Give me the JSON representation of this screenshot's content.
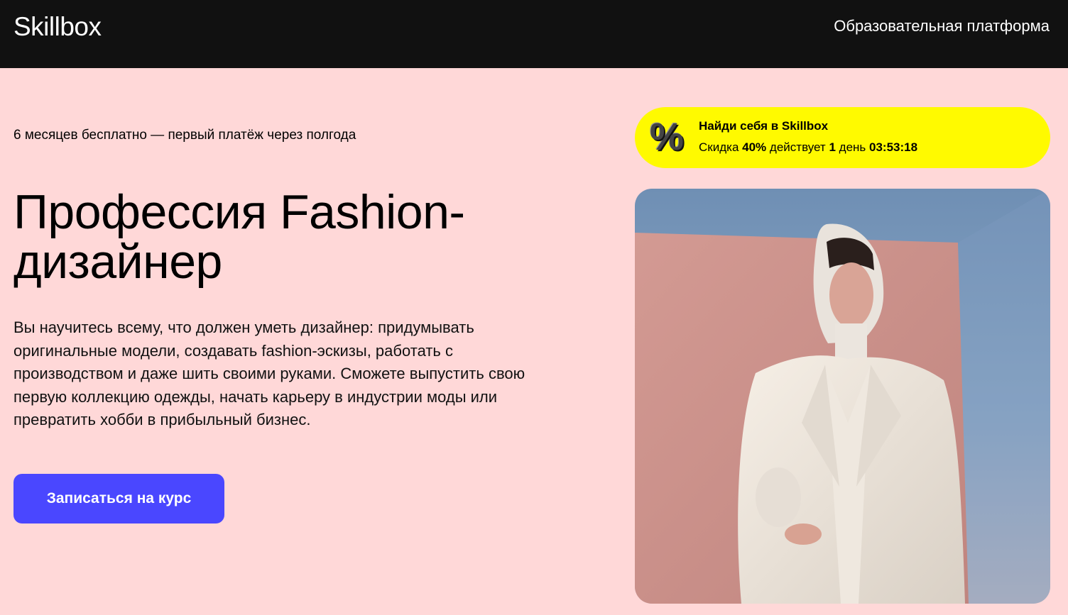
{
  "header": {
    "logo": "Skillbox",
    "platform_link": "Образовательная платформа"
  },
  "hero": {
    "promo_line": "6 месяцев бесплатно — первый платёж через полгода",
    "title": "Профессия Fashion-дизайнер",
    "description": "Вы научитесь всему, что должен уметь дизайнер: придумывать оригинальные модели, создавать fashion-эскизы, работать с производством и даже шить своими руками. Сможете выпустить свою первую коллекцию одежды, начать карьеру в индустрии моды или превратить хобби в прибыльный бизнес.",
    "cta_label": "Записаться на курс"
  },
  "discount": {
    "icon": "percent-icon",
    "icon_glyph": "%",
    "title": "Найди себя в Skillbox",
    "prefix": "Скидка",
    "percent": "40%",
    "middle": "действует",
    "days": "1",
    "days_label": "день",
    "timer": "03:53:18"
  },
  "colors": {
    "page_background": "#ffd8d8",
    "header_background": "#111111",
    "cta_background": "#4a47ff",
    "discount_background": "#fffa00"
  }
}
